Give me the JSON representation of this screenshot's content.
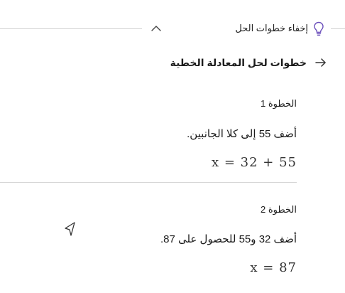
{
  "header": {
    "hide_steps_label": "إخفاء خطوات الحل",
    "bulb_icon": "lightbulb-icon",
    "collapse_icon": "chevron-up-icon"
  },
  "section": {
    "arrow_icon": "arrow-right-icon",
    "title": "خطوات لحل المعادلة الخطية"
  },
  "steps": [
    {
      "label": "الخطوة 1",
      "text": "أضف 55 إلى كلا الجانبين.",
      "math": "x = 32 + 55"
    },
    {
      "label": "الخطوة 2",
      "text": "أضف 32 و55 للحصول على 87.",
      "math": "x = 87"
    }
  ]
}
